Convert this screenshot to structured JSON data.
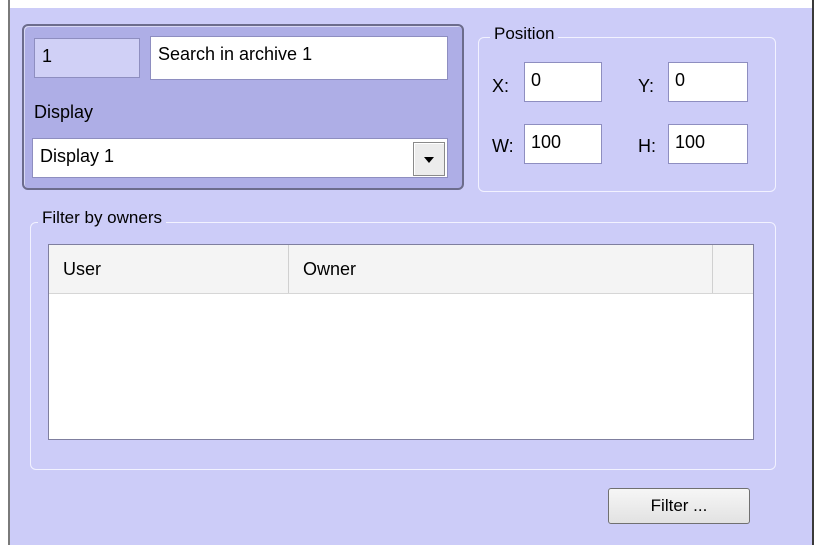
{
  "main": {
    "id_value": "1",
    "name_value": "Search in archive 1",
    "display_label": "Display",
    "display_selected": "Display 1"
  },
  "position": {
    "legend": "Position",
    "x_label": "X:",
    "x_value": "0",
    "y_label": "Y:",
    "y_value": "0",
    "w_label": "W:",
    "w_value": "100",
    "h_label": "H:",
    "h_value": "100"
  },
  "owners": {
    "legend": "Filter by owners",
    "columns": [
      "User",
      "Owner"
    ],
    "rows": []
  },
  "actions": {
    "filter_label": "Filter ..."
  },
  "colors": {
    "background": "#ccccf8",
    "selected_panel": "#aeaee6"
  }
}
